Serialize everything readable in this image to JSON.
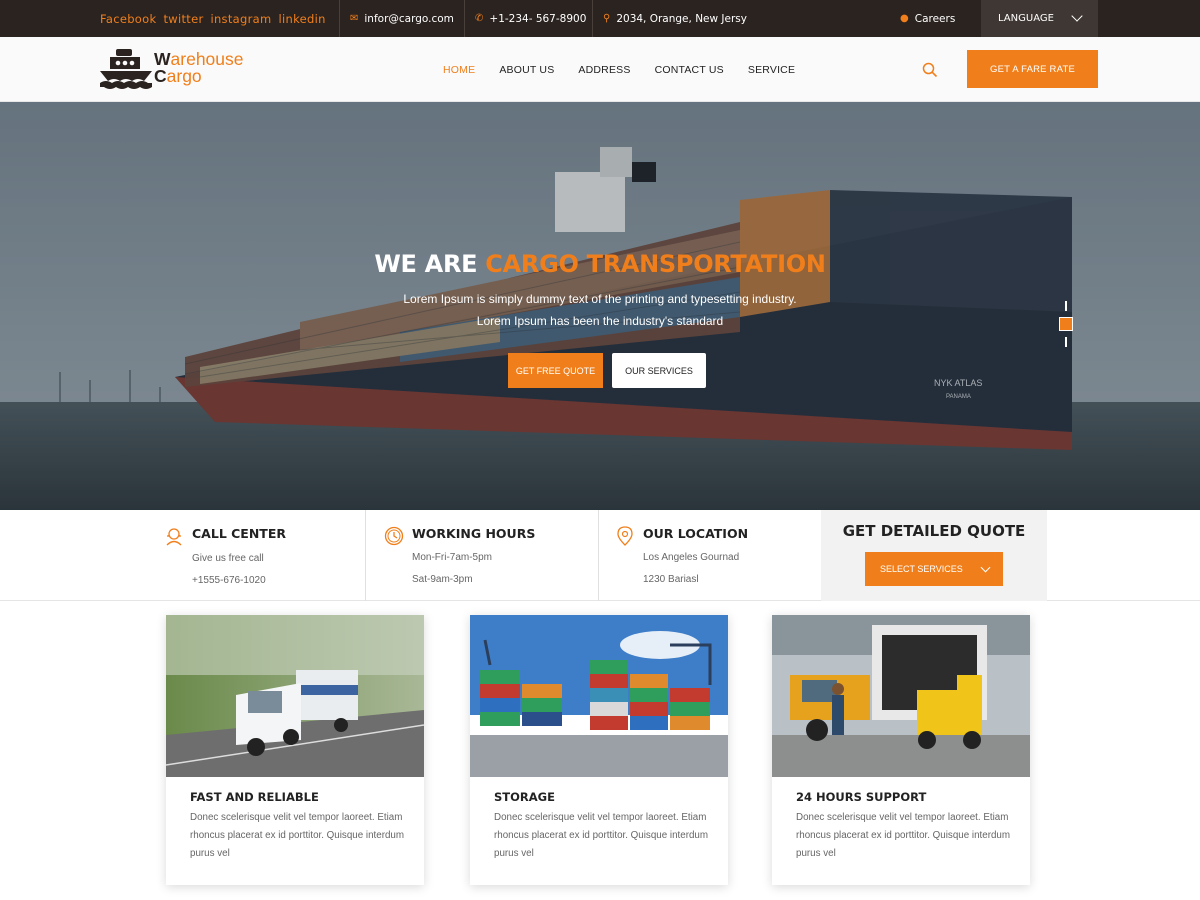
{
  "topbar": {
    "social": [
      "Facebook",
      "twitter",
      "instagram",
      "linkedin"
    ],
    "email": "infor@cargo.com",
    "phone": "+1-234- 567-8900",
    "address": "2034, Orange, New Jersy",
    "careers": "Careers",
    "language": "LANGUAGE"
  },
  "brand": {
    "line1_first": "W",
    "line1_rest": "arehouse",
    "line2_first": "C",
    "line2_rest": "argo"
  },
  "nav": {
    "items": [
      "HOME",
      "ABOUT US",
      "ADDRESS",
      "CONTACT US",
      "SERVICE"
    ],
    "cta": "GET A FARE RATE"
  },
  "hero": {
    "title_white": "WE ARE ",
    "title_orange": "CARGO TRANSPORTATION",
    "line1": "Lorem Ipsum is simply dummy text of the printing and typesetting industry.",
    "line2": "Lorem Ipsum has been the industry's standard",
    "btn_quote": "GET FREE QUOTE",
    "btn_services": "OUR SERVICES",
    "ship_name": "NYK ATLAS",
    "ship_port": "PANAMA"
  },
  "info": [
    {
      "title": "CALL CENTER",
      "line1": "Give us free call",
      "line2": "+1555-676-1020"
    },
    {
      "title": "WORKING HOURS",
      "line1": "Mon-Fri-7am-5pm",
      "line2": "Sat-9am-3pm"
    },
    {
      "title": "OUR LOCATION",
      "line1": "Los Angeles Gournad",
      "line2": "1230 Bariasl"
    }
  ],
  "quote": {
    "title": "GET DETAILED QUOTE",
    "select": "SELECT SERVICES"
  },
  "cards": [
    {
      "title": "FAST AND RELIABLE",
      "text": "Donec scelerisque velit vel tempor laoreet. Etiam rhoncus placerat ex id porttitor. Quisque interdum purus vel"
    },
    {
      "title": "STORAGE",
      "text": "Donec scelerisque velit vel tempor laoreet. Etiam rhoncus placerat ex id porttitor. Quisque interdum purus vel"
    },
    {
      "title": "24 HOURS SUPPORT",
      "text": "Donec scelerisque velit vel tempor laoreet. Etiam rhoncus placerat ex id porttitor. Quisque interdum purus vel"
    }
  ],
  "colors": {
    "accent": "#f07f1b",
    "dark": "#2b2320"
  }
}
